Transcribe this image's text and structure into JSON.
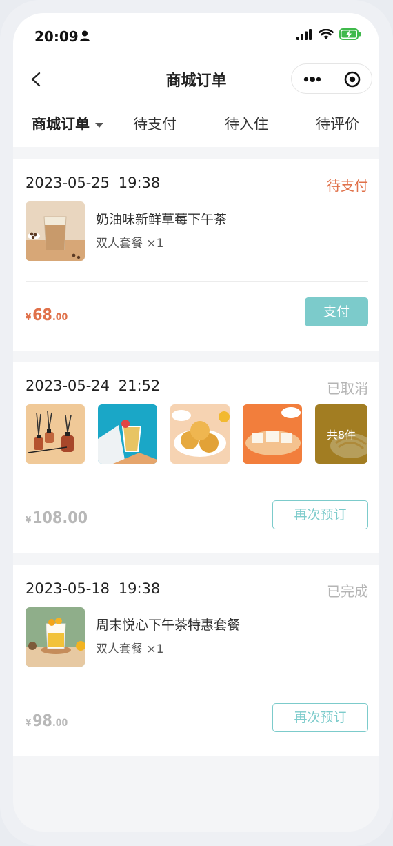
{
  "status_bar": {
    "time": "20:09"
  },
  "nav": {
    "title": "商城订单"
  },
  "tabs": [
    {
      "label": "商城订单",
      "active": true
    },
    {
      "label": "待支付"
    },
    {
      "label": "待入住"
    },
    {
      "label": "待评价"
    }
  ],
  "orders": [
    {
      "date": "2023-05-25 19:38",
      "status": "待支付",
      "item_name": "奶油味新鲜草莓下午茶",
      "item_qty": "双人套餐 ×1",
      "currency": "¥",
      "price_int": "68",
      "price_dec": ".00",
      "button": "支付"
    },
    {
      "date": "2023-05-24 21:52",
      "status": "已取消",
      "more_count": "共8件",
      "currency": "¥",
      "price_int": "108.00",
      "price_dec": "",
      "button": "再次预订"
    },
    {
      "date": "2023-05-18 19:38",
      "status": "已完成",
      "item_name": "周末悦心下午茶特惠套餐",
      "item_qty": "双人套餐 ×1",
      "currency": "¥",
      "price_int": "98",
      "price_dec": ".00",
      "button": "再次预订"
    }
  ],
  "colors": {
    "accent": "#7ccbcb",
    "pending": "#e0714a",
    "muted": "#b5b5b5"
  }
}
